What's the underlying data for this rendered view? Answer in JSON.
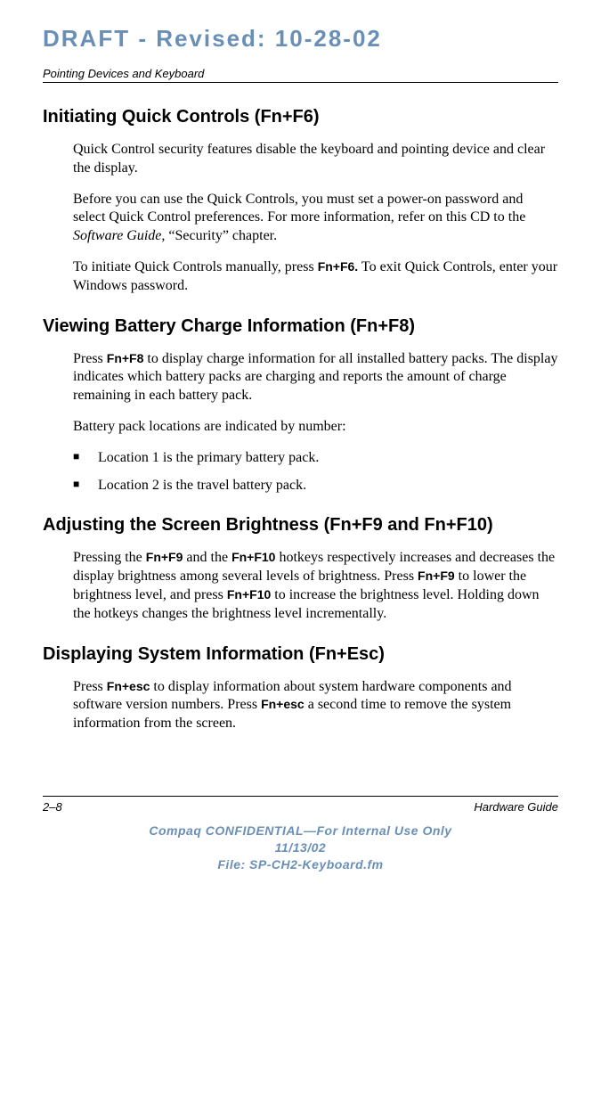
{
  "draft_banner": "DRAFT - Revised: 10-28-02",
  "running_head": "Pointing Devices and Keyboard",
  "sections": {
    "s1": {
      "heading": "Initiating Quick Controls (Fn+F6)",
      "p1": "Quick Control security features disable the keyboard and pointing device and clear the display.",
      "p2_a": "Before you can use the Quick Controls, you must set a power-on password and select Quick Control preferences. For more information, refer on this CD to the ",
      "p2_ital": "Software Guide,",
      "p2_b": " “Security” chapter.",
      "p3_a": "To initiate Quick Controls manually, press ",
      "p3_key": "Fn+F6.",
      "p3_b": " To exit Quick Controls, enter your Windows password."
    },
    "s2": {
      "heading": "Viewing Battery Charge Information (Fn+F8)",
      "p1_a": "Press ",
      "p1_key": "Fn+F8",
      "p1_b": " to display charge information for all installed battery packs. The display indicates which battery packs are charging and reports the amount of charge remaining in each battery pack.",
      "p2": "Battery pack locations are indicated by number:",
      "li1": "Location 1 is the primary battery pack.",
      "li2": "Location 2 is the travel battery pack."
    },
    "s3": {
      "heading": "Adjusting the Screen Brightness (Fn+F9 and Fn+F10)",
      "p1_a": "Pressing the ",
      "p1_k1": "Fn+F9",
      "p1_b": " and the ",
      "p1_k2": "Fn+F10",
      "p1_c": " hotkeys respectively increases and decreases the display brightness among several levels of brightness. Press ",
      "p1_k3": "Fn+F9",
      "p1_d": " to lower the brightness level, and press ",
      "p1_k4": "Fn+F10",
      "p1_e": " to increase the brightness level. Holding down the hotkeys changes the brightness level incrementally."
    },
    "s4": {
      "heading": "Displaying System Information (Fn+Esc)",
      "p1_a": "Press ",
      "p1_k1": "Fn+esc",
      "p1_b": " to display information about system hardware components and software version numbers. Press ",
      "p1_k2": "Fn+esc",
      "p1_c": " a second time to remove the system information from the screen."
    }
  },
  "footer": {
    "page_number": "2–8",
    "guide_name": "Hardware Guide",
    "conf_line1": "Compaq CONFIDENTIAL—For Internal Use Only",
    "conf_line2": "11/13/02",
    "conf_line3": "File: SP-CH2-Keyboard.fm"
  }
}
